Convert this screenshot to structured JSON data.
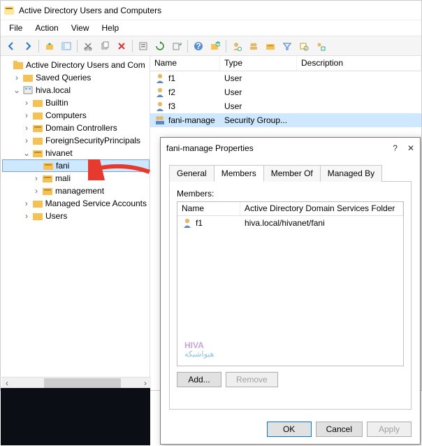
{
  "window": {
    "title": "Active Directory Users and Computers",
    "menu": {
      "file": "File",
      "action": "Action",
      "view": "View",
      "help": "Help"
    }
  },
  "tree": {
    "root": "Active Directory Users and Com",
    "saved": "Saved Queries",
    "domain": "hiva.local",
    "children": {
      "builtin": "Builtin",
      "computers": "Computers",
      "dc": "Domain Controllers",
      "fsp": "ForeignSecurityPrincipals",
      "hivanet": "hivanet",
      "fani": "fani",
      "mali": "mali",
      "management": "management",
      "msa": "Managed Service Accounts",
      "users": "Users"
    }
  },
  "list": {
    "headers": {
      "name": "Name",
      "type": "Type",
      "desc": "Description"
    },
    "rows": [
      {
        "name": "f1",
        "type": "User",
        "kind": "user"
      },
      {
        "name": "f2",
        "type": "User",
        "kind": "user"
      },
      {
        "name": "f3",
        "type": "User",
        "kind": "user"
      },
      {
        "name": "fani-manage",
        "type": "Security Group...",
        "kind": "group",
        "selected": true
      }
    ]
  },
  "dialog": {
    "title": "fani-manage Properties",
    "tabs": {
      "general": "General",
      "members": "Members",
      "memberof": "Member Of",
      "managedby": "Managed By"
    },
    "members_label": "Members:",
    "members_headers": {
      "name": "Name",
      "folder": "Active Directory Domain Services Folder"
    },
    "members_rows": [
      {
        "name": "f1",
        "folder": "hiva.local/hivanet/fani"
      }
    ],
    "buttons": {
      "add": "Add...",
      "remove": "Remove",
      "ok": "OK",
      "cancel": "Cancel",
      "apply": "Apply"
    },
    "watermark": {
      "brand": "HIVA",
      "sub": "هیواشبکه"
    }
  }
}
